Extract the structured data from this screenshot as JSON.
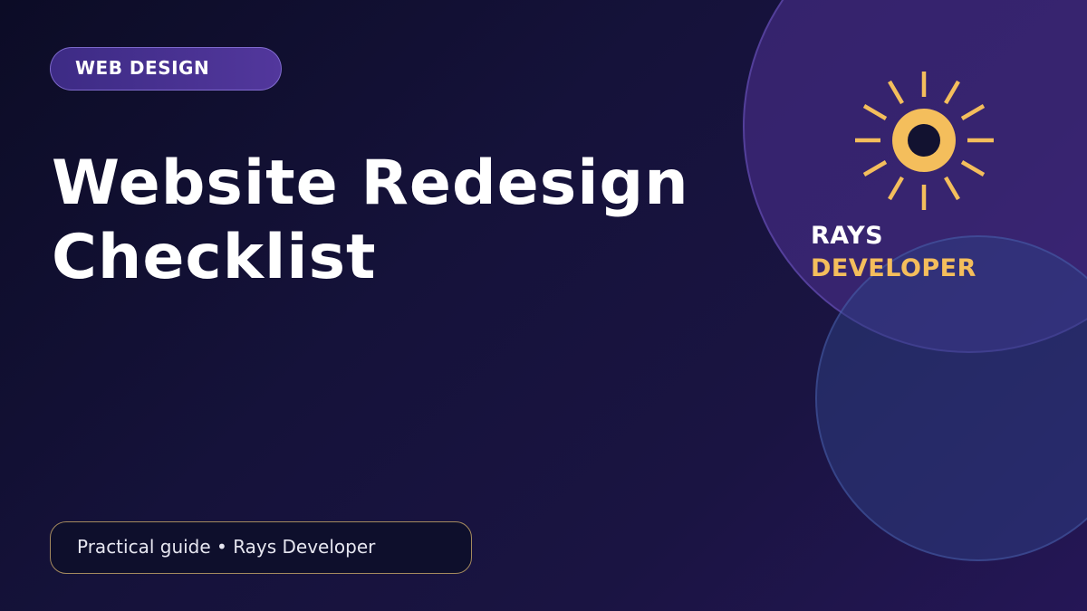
{
  "badge": {
    "label": "WEB DESIGN"
  },
  "title": {
    "line1": "Website Redesign",
    "line2": "Checklist"
  },
  "footer": {
    "text": "Practical guide • Rays Developer"
  },
  "brand": {
    "name_line1": "RAYS",
    "name_line2": "DEVELOPER",
    "logo_icon": "sun-icon"
  },
  "colors": {
    "accent_gold": "#f4be5c",
    "badge_purple": "#52379c",
    "background_dark": "#0c0c26",
    "text_white": "#ffffff"
  }
}
